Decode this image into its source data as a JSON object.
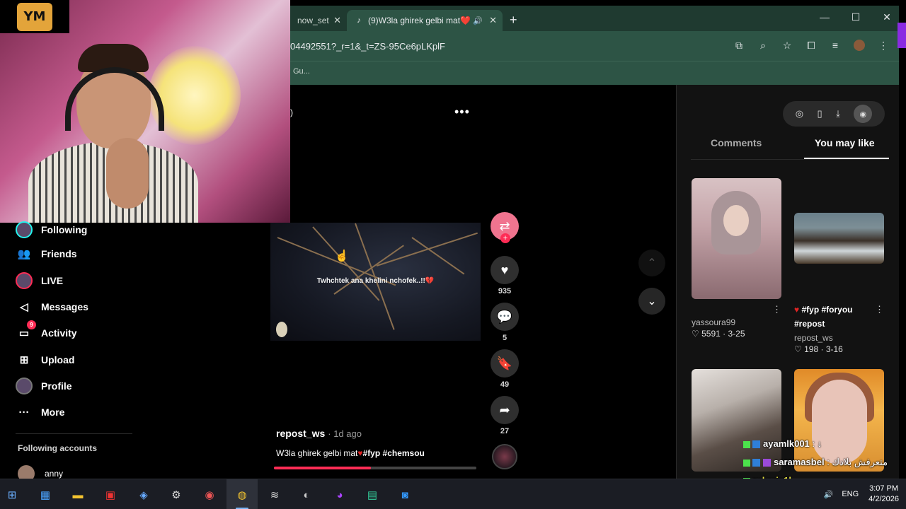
{
  "browser": {
    "tabs": [
      {
        "label": "now_set"
      },
      {
        "label": "(9)W3la ghirek gelbi mat❤️",
        "favicon": "tiktok-icon"
      }
    ],
    "url": "04492551?_r=1&_t=ZS-95Ce6pLKplF",
    "bookmark": "Gu..."
  },
  "logo": {
    "text": "YM"
  },
  "sidebar": {
    "items": [
      {
        "label": "Following",
        "icon": "following-avatar-icon"
      },
      {
        "label": "Friends",
        "icon": "friends-icon"
      },
      {
        "label": "LIVE",
        "icon": "live-icon"
      },
      {
        "label": "Messages",
        "icon": "messages-icon"
      },
      {
        "label": "Activity",
        "icon": "activity-icon",
        "badge": "9"
      },
      {
        "label": "Upload",
        "icon": "upload-icon"
      },
      {
        "label": "Profile",
        "icon": "profile-icon"
      },
      {
        "label": "More",
        "icon": "more-icon"
      }
    ],
    "following_title": "Following accounts",
    "account": {
      "name": "anny"
    }
  },
  "video": {
    "caption": "Twhchtek ana khelini nchofek..!!💔",
    "author": "repost_ws",
    "time": "· 1d ago",
    "description": "W3la ghirek gelbi mat",
    "tags": "#fyp #chemsou",
    "progress": 0.48
  },
  "actions": {
    "likes": "935",
    "comments": "5",
    "saves": "49",
    "shares": "27"
  },
  "right_panel": {
    "tabs": [
      "Comments",
      "You may like"
    ],
    "active_tab": "You may like",
    "cards": [
      {
        "author": "yassoura99",
        "likes": "5591",
        "date": "3-25"
      },
      {
        "title": "#fyp #foryou #repost",
        "author": "repost_ws",
        "likes": "198",
        "date": "3-16"
      }
    ]
  },
  "chat": [
    {
      "user": "ayamlk001",
      "message": ":",
      "extra": "↓"
    },
    {
      "user": "saramasbel",
      "message": ": متعرفش بلادك"
    },
    {
      "user": "zakaria1l",
      "message": ""
    },
    {
      "user": "ayamlk001",
      "message": ":"
    }
  ],
  "taskbar": {
    "language": "ENG",
    "time": "3:07 PM",
    "date": "4/2/2026"
  }
}
